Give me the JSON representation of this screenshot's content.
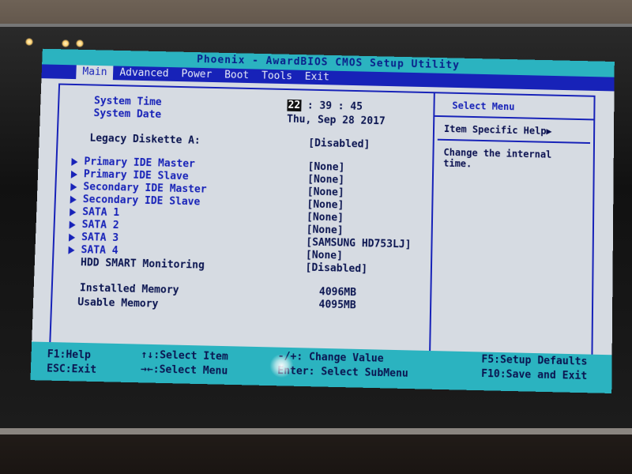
{
  "title": "Phoenix - AwardBIOS CMOS Setup Utility",
  "menu": [
    {
      "label": "Main",
      "active": true
    },
    {
      "label": "Advanced"
    },
    {
      "label": "Power"
    },
    {
      "label": "Boot"
    },
    {
      "label": "Tools"
    },
    {
      "label": "Exit"
    }
  ],
  "main": {
    "system_time_label": "System Time",
    "system_time_hour": "22",
    "system_time_rest": ": 39 : 45",
    "system_date_label": "System Date",
    "system_date_value": "Thu, Sep 28 2017",
    "legacy_label": "Legacy Diskette A:",
    "legacy_value": "[Disabled]",
    "items": [
      {
        "label": "Primary IDE Master",
        "value": "[None]"
      },
      {
        "label": "Primary IDE Slave",
        "value": "[None]"
      },
      {
        "label": "Secondary IDE Master",
        "value": "[None]"
      },
      {
        "label": "Secondary IDE Slave",
        "value": "[None]"
      },
      {
        "label": "SATA 1",
        "value": "[None]"
      },
      {
        "label": "SATA 2",
        "value": "[None]"
      },
      {
        "label": "SATA 3",
        "value": "[SAMSUNG HD753LJ]"
      },
      {
        "label": "SATA 4",
        "value": "[None]"
      }
    ],
    "smart_label": "HDD SMART Monitoring",
    "smart_value": "[Disabled]",
    "installed_label": "Installed Memory",
    "installed_value": "4096MB",
    "usable_label": "Usable Memory",
    "usable_value": "4095MB"
  },
  "help": {
    "title": "Select Menu",
    "header": "Item Specific Help▶",
    "text": "Change the internal time."
  },
  "footer": {
    "f1": "F1:Help",
    "esc": "ESC:Exit",
    "select_item": "↑↓:Select Item",
    "select_menu": "→←:Select Menu",
    "change_value": "-/+: Change Value",
    "enter": "Enter: Select SubMenu",
    "f5": "F5:Setup Defaults",
    "f10": "F10:Save and Exit"
  },
  "colors": {
    "cyan": "#2bb3c0",
    "blue": "#1722b8",
    "screen_bg": "#d6dbe2"
  }
}
